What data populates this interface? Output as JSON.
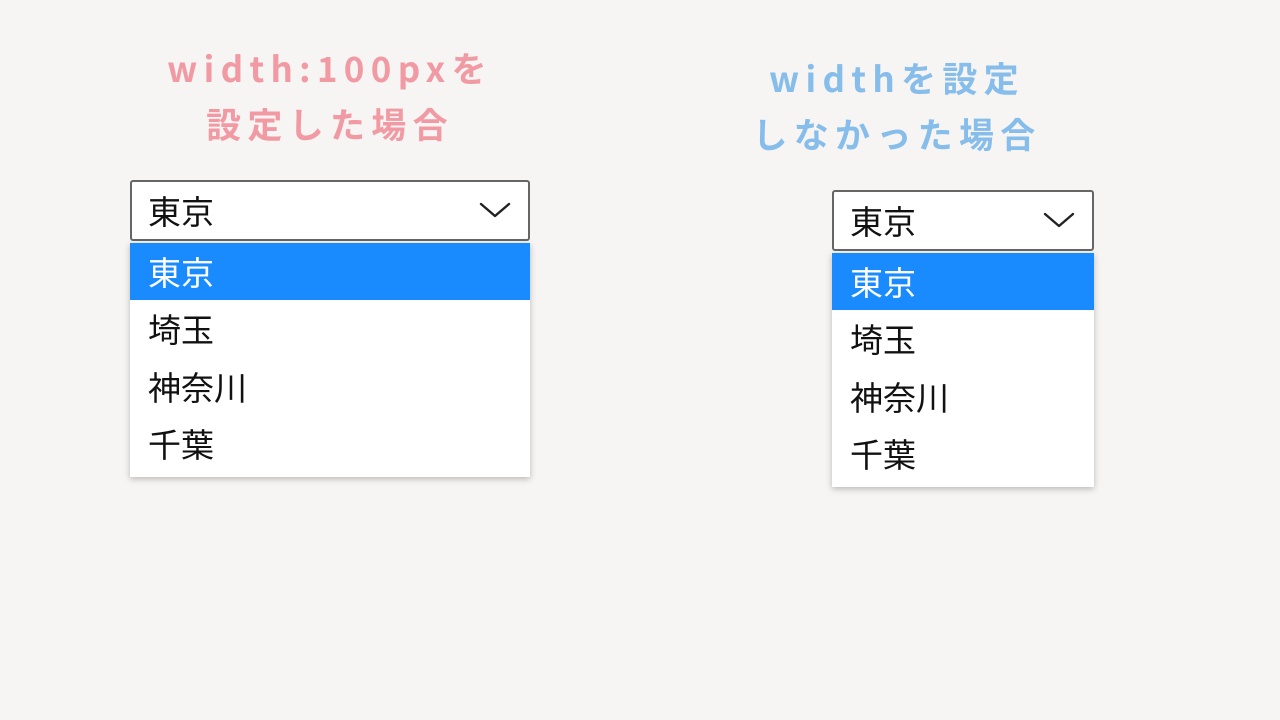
{
  "left": {
    "heading": "width:100pxを\n設定した場合",
    "selected": "東京",
    "options": [
      "東京",
      "埼玉",
      "神奈川",
      "千葉"
    ]
  },
  "right": {
    "heading": "widthを設定\nしなかった場合",
    "selected": "東京",
    "options": [
      "東京",
      "埼玉",
      "神奈川",
      "千葉"
    ]
  },
  "colors": {
    "heading_left": "#f29aa4",
    "heading_right": "#87bdea",
    "highlight": "#1a8bff"
  }
}
